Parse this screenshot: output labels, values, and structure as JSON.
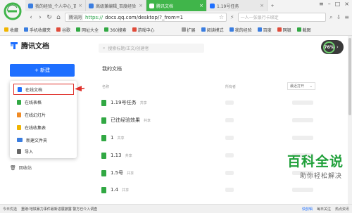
{
  "browser": {
    "tabs": [
      {
        "label": "我的经验_个人中心_百度经验",
        "color": "#3a7de0",
        "active": false
      },
      {
        "label": "高级兼编辑_百度经验",
        "color": "#3a7de0",
        "active": false
      },
      {
        "label": "腾讯文档",
        "color": "#ffffff",
        "active": true
      },
      {
        "label": "1.19号任务",
        "color": "#1e6fff",
        "active": false
      }
    ],
    "address": {
      "site_tag": "腾讯网",
      "protocol": "https://",
      "url": "docs.qq.com/desktop/?_from=1"
    },
    "web_search_placeholder": "一人一张银行卡绑定",
    "bookmarks": [
      {
        "label": "收藏",
        "color": "#f0b400"
      },
      {
        "label": "手机收藏夹",
        "color": "#3a7de0"
      },
      {
        "label": "谷歌",
        "color": "#e04b3a"
      },
      {
        "label": "网址大全",
        "color": "#31a843"
      },
      {
        "label": "360搜索",
        "color": "#31a843"
      },
      {
        "label": "游戏中心",
        "color": "#e04b3a"
      },
      {
        "label": "扩展",
        "color": "#999999"
      },
      {
        "label": "阅读模式",
        "color": "#3a7de0"
      },
      {
        "label": "我的经验",
        "color": "#3a7de0"
      },
      {
        "label": "百度",
        "color": "#3a7de0"
      },
      {
        "label": "网银",
        "color": "#e04b3a"
      },
      {
        "label": "截图",
        "color": "#31a843"
      }
    ]
  },
  "app": {
    "brand": "腾讯文档",
    "new_button": "+ 新建",
    "new_menu": [
      {
        "label": "在线文档",
        "color": "#1e6fff",
        "selected": true
      },
      {
        "label": "在线表格",
        "color": "#31a843",
        "selected": false
      },
      {
        "label": "在线幻灯片",
        "color": "#f08a24",
        "selected": false
      },
      {
        "label": "在线收集表",
        "color": "#f0b400",
        "selected": false
      },
      {
        "label": "新建文件夹",
        "color": "#3a7de0",
        "selected": false
      },
      {
        "label": "导入",
        "color": "#666666",
        "selected": false
      }
    ],
    "recycle_bin": "回收站",
    "search_placeholder": "搜索标题/正文/创建者",
    "perf_percent": "76%",
    "section_title": "我的文档",
    "header_name": "名称",
    "header_owner": "所有者",
    "sort_label": "最近打开",
    "docs": [
      {
        "title": "1.19号任务",
        "shared": "共享"
      },
      {
        "title": "已往经验效果",
        "shared": "共享"
      },
      {
        "title": "1",
        "shared": "共享"
      },
      {
        "title": "1.13",
        "shared": "共享"
      },
      {
        "title": "1.5号",
        "shared": "共享"
      },
      {
        "title": "1.4",
        "shared": "共享"
      }
    ]
  },
  "status": {
    "left": "今日优选",
    "ticker": "重磅:地铁暴力事件最新进展披露 警方已介入调查",
    "items": [
      "快剪辑",
      "每日关注",
      "热点资讯"
    ]
  },
  "watermark": {
    "title": "百科全说",
    "subtitle": "助你轻松解决"
  },
  "colors": {
    "accent": "#1e6fff",
    "doc_green": "#31a843",
    "tab_green": "#40b54a",
    "highlight_red": "#e0302b"
  }
}
